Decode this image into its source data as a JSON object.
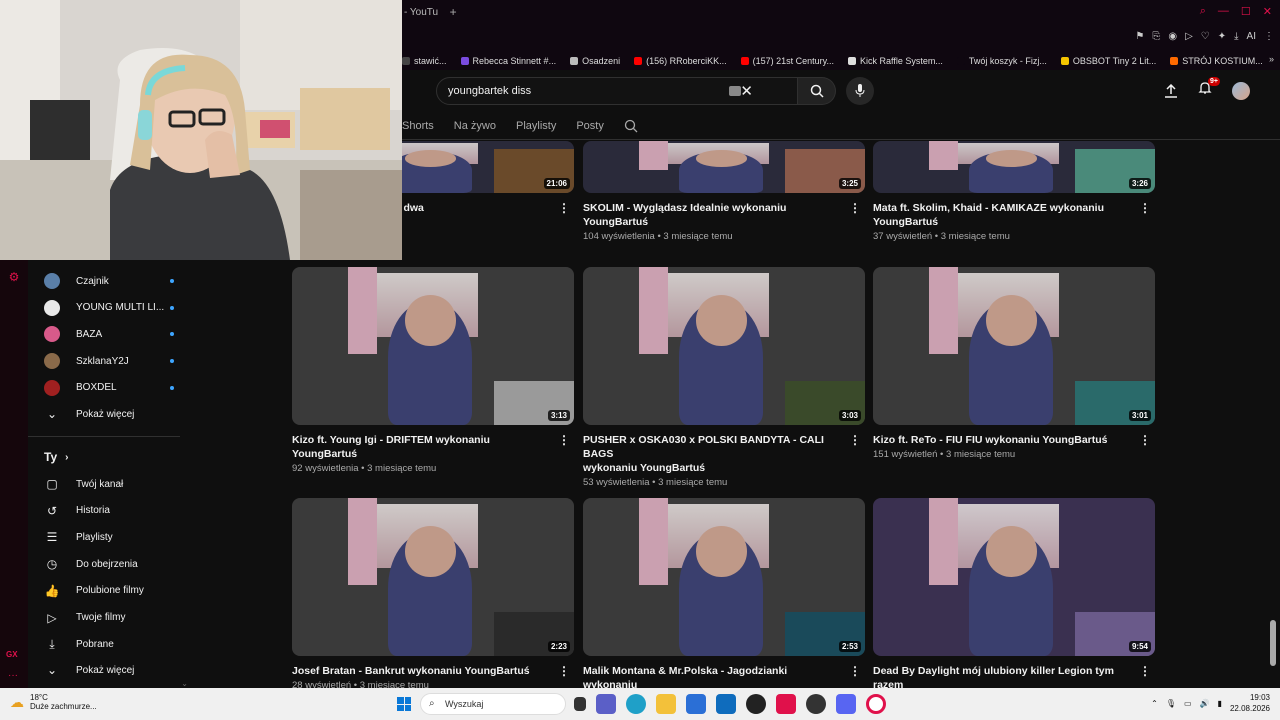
{
  "browser": {
    "tab_title": "- YouTu",
    "bookmarks": [
      {
        "label": "stawić...",
        "color": "#444"
      },
      {
        "label": "Rebecca Stinnett #...",
        "color": "#7a4be0"
      },
      {
        "label": "Osadzeni",
        "color": "#bbb"
      },
      {
        "label": "(156) RRoberciKK...",
        "color": "#ff0000"
      },
      {
        "label": "(157) 21st Century...",
        "color": "#ff0000"
      },
      {
        "label": "Kick Raffle System...",
        "color": "#ddd"
      },
      {
        "label": "Twój koszyk - Fizj...",
        "color": "#0f0710"
      },
      {
        "label": "OBSBOT Tiny 2 Lit...",
        "color": "#f5c400"
      },
      {
        "label": "STRÓJ KOSTIUM...",
        "color": "#ff6a00"
      }
    ]
  },
  "youtube": {
    "search_query": "youngbartek diss",
    "notification_count": "9+",
    "channel_tabs": [
      "Shorts",
      "Na żywo",
      "Playlisty",
      "Posty"
    ]
  },
  "sidebar": {
    "subscriptions": [
      {
        "name": "Czajnik",
        "color": "#5a7fa8"
      },
      {
        "name": "YOUNG MULTI LI...",
        "color": "#e8e8e8"
      },
      {
        "name": "BAZA",
        "color": "#d85a8a"
      },
      {
        "name": "SzklanaY2J",
        "color": "#8a6a4a"
      },
      {
        "name": "BOXDEL",
        "color": "#a02020"
      }
    ],
    "show_more": "Pokaż więcej",
    "you_heading": "Ty",
    "you_items": [
      {
        "label": "Twój kanał",
        "icon": "person-icon"
      },
      {
        "label": "Historia",
        "icon": "history-icon"
      },
      {
        "label": "Playlisty",
        "icon": "playlist-icon"
      },
      {
        "label": "Do obejrzenia",
        "icon": "clock-icon"
      },
      {
        "label": "Polubione filmy",
        "icon": "thumbs-up-icon"
      },
      {
        "label": "Twoje filmy",
        "icon": "play-icon"
      },
      {
        "label": "Pobrane",
        "icon": "download-icon"
      }
    ],
    "show_more_2": "Pokaż więcej"
  },
  "videos": [
    {
      "title": "...wóch skrzynek i dbde dwa ...ku",
      "line1": "wóch skrzynek i dbde dwa",
      "line2": "ku",
      "meta": "temu",
      "duration": "21:06",
      "bg": "#2a2420",
      "inset": "#6a4a2a"
    },
    {
      "title": "SKOLIM - Wyglądasz Idealnie wykonaniu YoungBartuś",
      "line1": "SKOLIM - Wyglądasz Idealnie wykonaniu YoungBartuś",
      "line2": "",
      "meta": "104 wyświetlenia • 3 miesiące temu",
      "duration": "3:25",
      "bg": "#25283a",
      "inset": "#8a5a4a"
    },
    {
      "title": "Mata ft. Skolim, Khaid - KAMIKAZE wykonaniu YoungBartuś",
      "line1": "Mata ft. Skolim, Khaid - KAMIKAZE wykonaniu",
      "line2": "YoungBartuś",
      "meta": "37 wyświetleń • 3 miesiące temu",
      "duration": "3:26",
      "bg": "#25283a",
      "inset": "#4a8a7a"
    },
    {
      "title": "Kizo ft. Young Igi - DRIFTEM wykonaniu YoungBartuś",
      "line1": "Kizo ft. Young Igi - DRIFTEM  wykonaniu YoungBartuś",
      "line2": "",
      "meta": "92 wyświetlenia • 3 miesiące temu",
      "duration": "3:13",
      "bg": "#3a3a3a",
      "inset": "#9a9a9a"
    },
    {
      "title": "PUSHER x OSKA030 x POLSKI BANDYTA - CALI BAGS wykonaniu YoungBartuś",
      "line1": "PUSHER x OSKA030 x POLSKI BANDYTA - CALI BAGS",
      "line2": "wykonaniu YoungBartuś",
      "meta": "53 wyświetlenia • 3 miesiące temu",
      "duration": "3:03",
      "bg": "#3a3a3a",
      "inset": "#3a4a2a"
    },
    {
      "title": "Kizo ft. ReTo - FIU FIU wykonaniu YoungBartuś",
      "line1": "Kizo ft. ReTo - FIU FIU wykonaniu YoungBartuś",
      "line2": "",
      "meta": "151 wyświetleń • 3 miesiące temu",
      "duration": "3:01",
      "bg": "#3a3a3a",
      "inset": "#2a6a6a"
    },
    {
      "title": "Josef Bratan - Bankrut wykonaniu YoungBartuś",
      "line1": "Josef Bratan - Bankrut wykonaniu YoungBartuś",
      "line2": "",
      "meta": "28 wyświetleń • 3 miesiące temu",
      "duration": "2:23",
      "bg": "#3a3a3a",
      "inset": "#2a2a2a"
    },
    {
      "title": "Malik Montana & Mr.Polska - Jagodzianki wykonaniu YoungBartuś",
      "line1": "Malik Montana & Mr.Polska - Jagodzianki wykonaniu",
      "line2": "YoungBartuś",
      "meta": "",
      "duration": "2:53",
      "bg": "#3a3a3a",
      "inset": "#1a4a5a"
    },
    {
      "title": "Dead By Daylight mój ulubiony killer Legion tym razem udało się (4k no escaped killer good)",
      "line1": "Dead By Daylight mój ulubiony killer Legion tym razem",
      "line2": "udało się (4k no escaped killer good)",
      "meta": "",
      "duration": "9:54",
      "bg": "#3a3050",
      "inset": "#6a5a8a"
    }
  ],
  "taskbar": {
    "temperature": "18°C",
    "weather": "Duże zachmurze...",
    "search_placeholder": "Wyszukaj",
    "time": "19:03",
    "date": "22.08.2026"
  }
}
